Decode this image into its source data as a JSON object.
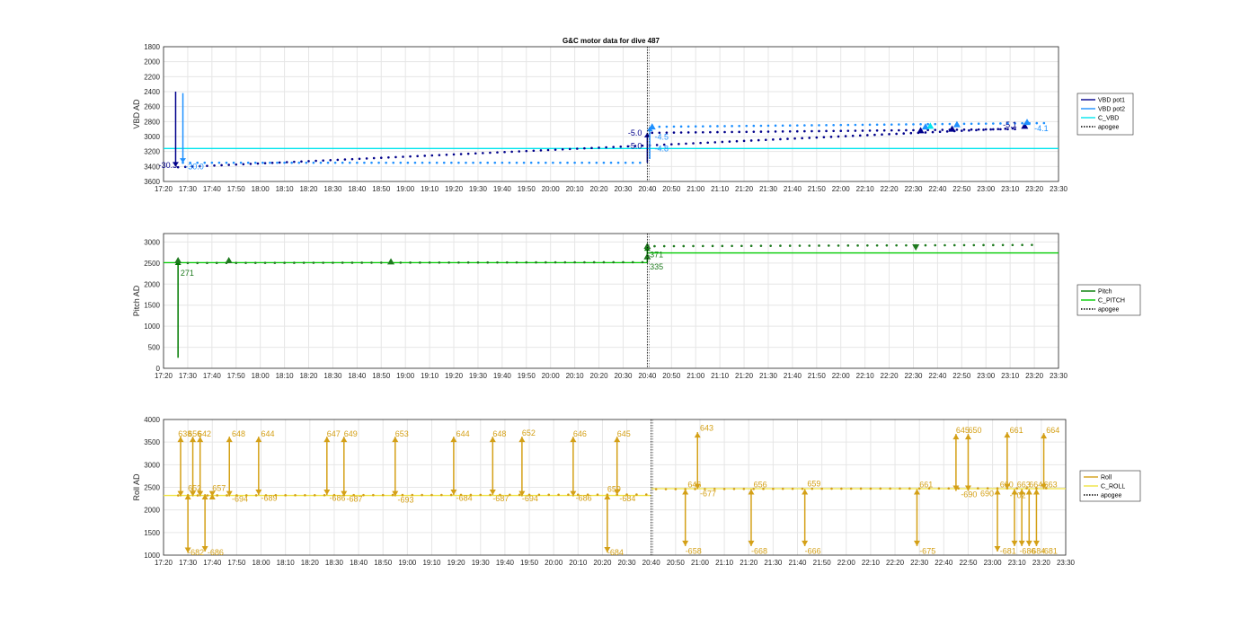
{
  "title": "G&C motor data for dive 487",
  "x_ticks": [
    "17:20",
    "17:30",
    "17:40",
    "17:50",
    "18:00",
    "18:10",
    "18:20",
    "18:30",
    "18:40",
    "18:50",
    "19:00",
    "19:10",
    "19:20",
    "19:30",
    "19:40",
    "19:50",
    "20:00",
    "20:10",
    "20:20",
    "20:30",
    "20:40",
    "20:50",
    "21:00",
    "21:10",
    "21:20",
    "21:30",
    "21:40",
    "21:50",
    "22:00",
    "22:10",
    "22:20",
    "22:30",
    "22:40",
    "22:50",
    "23:00",
    "23:10",
    "23:20",
    "23:30"
  ],
  "apogee_time": "20:40",
  "chart_data": [
    {
      "type": "line",
      "name": "vbd",
      "ylabel": "VBD AD",
      "yreverse": true,
      "ylim": [
        1800,
        3600
      ],
      "yticks": [
        1800,
        2000,
        2200,
        2400,
        2600,
        2800,
        3000,
        3200,
        3400,
        3600
      ],
      "xlim": [
        "17:20",
        "23:30"
      ],
      "grid": true,
      "legend_position": "right",
      "legend": [
        {
          "label": "VBD pot1",
          "color": "#00008b",
          "style": "solid"
        },
        {
          "label": "VBD pot2",
          "color": "#1e90ff",
          "style": "solid"
        },
        {
          "label": "C_VBD",
          "color": "#00e5ee",
          "style": "solid"
        },
        {
          "label": "apogee",
          "color": "#000000",
          "style": "dotted"
        }
      ],
      "series": [
        {
          "name": "VBD pot1",
          "color": "#00008b",
          "dots": [
            [
              "17:26",
              3410
            ],
            [
              "23:12",
              2890
            ]
          ],
          "spacing_min": 3,
          "dots2": [
            [
              "20:42",
              2950
            ],
            [
              "23:14",
              2900
            ]
          ]
        },
        {
          "name": "VBD pot2",
          "color": "#1e90ff",
          "dots": [
            [
              "17:28",
              3350
            ],
            [
              "20:38",
              3350
            ]
          ],
          "spacing_min": 3,
          "dots2": [
            [
              "20:42",
              2870
            ],
            [
              "23:24",
              2820
            ]
          ]
        },
        {
          "name": "C_VBD",
          "color": "#00e5ee",
          "hline_segments": [
            [
              [
                "17:20",
                "20:40"
              ],
              3160
            ],
            [
              [
                "20:40",
                "23:30"
              ],
              3160
            ]
          ]
        }
      ],
      "pumps": [
        {
          "t": "17:25",
          "from": 2400,
          "to": 3400,
          "color": "#00008b"
        },
        {
          "t": "17:28",
          "from": 2420,
          "to": 3350,
          "color": "#1e90ff"
        },
        {
          "t": "20:40",
          "from": 3350,
          "to": 2950,
          "color": "#00008b"
        },
        {
          "t": "20:41",
          "from": 3300,
          "to": 2870,
          "color": "#1e90ff"
        }
      ],
      "markers": [
        {
          "t": "20:42",
          "v": 2870,
          "color": "#1e90ff",
          "dir": "up"
        },
        {
          "t": "22:33",
          "v": 2920,
          "color": "#00008b",
          "dir": "up"
        },
        {
          "t": "22:35",
          "v": 2870,
          "color": "#1e90ff",
          "dir": "up"
        },
        {
          "t": "22:37",
          "v": 2860,
          "color": "#00e5ee",
          "dir": "up"
        },
        {
          "t": "22:46",
          "v": 2900,
          "color": "#00008b",
          "dir": "up"
        },
        {
          "t": "22:48",
          "v": 2840,
          "color": "#1e90ff",
          "dir": "up"
        },
        {
          "t": "23:16",
          "v": 2860,
          "color": "#00008b",
          "dir": "up"
        },
        {
          "t": "23:17",
          "v": 2810,
          "color": "#1e90ff",
          "dir": "up"
        }
      ],
      "annotations": [
        {
          "text": "-5.0",
          "t": "20:32",
          "v": 2990,
          "color": "#00008b"
        },
        {
          "text": "-5.0",
          "t": "20:32",
          "v": 3160,
          "color": "#00008b"
        },
        {
          "text": "-4.5",
          "t": "20:43",
          "v": 3040,
          "color": "#1e90ff"
        },
        {
          "text": "-4.8",
          "t": "20:43",
          "v": 3200,
          "color": "#1e90ff"
        },
        {
          "text": "-5.1",
          "t": "23:07",
          "v": 2880,
          "color": "#00008b"
        },
        {
          "text": "-4.1",
          "t": "23:20",
          "v": 2930,
          "color": "#1e90ff"
        },
        {
          "text": "-30.3",
          "t": "17:18",
          "v": 3420,
          "color": "#00008b"
        },
        {
          "text": "-30.0",
          "t": "17:29",
          "v": 3440,
          "color": "#1e90ff"
        }
      ]
    },
    {
      "type": "line",
      "name": "pitch",
      "ylabel": "Pitch AD",
      "yreverse": false,
      "ylim": [
        0,
        3200
      ],
      "yticks": [
        0,
        500,
        1000,
        1500,
        2000,
        2500,
        3000
      ],
      "xlim": [
        "17:20",
        "23:30"
      ],
      "grid": true,
      "legend_position": "right",
      "legend": [
        {
          "label": "Pitch",
          "color": "#007a00",
          "style": "solid"
        },
        {
          "label": "C_PITCH",
          "color": "#00cc00",
          "style": "solid"
        },
        {
          "label": "apogee",
          "color": "#000000",
          "style": "dotted"
        }
      ],
      "series": [
        {
          "name": "Pitch",
          "color": "#1e7a1e",
          "dots": [
            [
              "17:26",
              2500
            ],
            [
              "20:38",
              2520
            ]
          ],
          "spacing_min": 4,
          "dots2": [
            [
              "20:43",
              2900
            ],
            [
              "23:22",
              2930
            ]
          ]
        },
        {
          "name": "C_PITCH",
          "color": "#00cc00",
          "hline_segments": [
            [
              [
                "17:20",
                "20:40"
              ],
              2510
            ],
            [
              [
                "20:40",
                "23:30"
              ],
              2740
            ]
          ]
        }
      ],
      "pumps": [
        {
          "t": "17:26",
          "from": 250,
          "to": 2560,
          "color": "#007a00"
        },
        {
          "t": "20:40",
          "from": 2500,
          "to": 2900,
          "color": "#007a00"
        }
      ],
      "markers": [
        {
          "t": "17:26",
          "v": 2560,
          "color": "#1e7a1e",
          "dir": "up"
        },
        {
          "t": "17:47",
          "v": 2560,
          "color": "#1e7a1e",
          "dir": "up"
        },
        {
          "t": "18:54",
          "v": 2530,
          "color": "#1e7a1e",
          "dir": "up"
        },
        {
          "t": "20:40",
          "v": 2650,
          "color": "#1e7a1e",
          "dir": "up"
        },
        {
          "t": "20:40",
          "v": 2900,
          "color": "#1e7a1e",
          "dir": "up"
        },
        {
          "t": "22:31",
          "v": 2880,
          "color": "#1e7a1e",
          "dir": "down"
        }
      ],
      "annotations": [
        {
          "text": "271",
          "t": "17:27",
          "v": 2200,
          "color": "#1e7a1e"
        },
        {
          "text": "371",
          "t": "20:41",
          "v": 2630,
          "color": "#1e7a1e"
        },
        {
          "text": "335",
          "t": "20:41",
          "v": 2350,
          "color": "#1e7a1e"
        }
      ]
    },
    {
      "type": "line",
      "name": "roll",
      "ylabel": "Roll AD",
      "yreverse": false,
      "ylim": [
        1000,
        4000
      ],
      "yticks": [
        1000,
        1500,
        2000,
        2500,
        3000,
        3500,
        4000
      ],
      "xlim": [
        "17:20",
        "23:30"
      ],
      "grid": true,
      "legend_position": "right",
      "legend": [
        {
          "label": "Roll",
          "color": "#d4a017",
          "style": "solid"
        },
        {
          "label": "C_ROLL",
          "color": "#f0e442",
          "style": "solid"
        },
        {
          "label": "apogee",
          "color": "#000000",
          "style": "dotted"
        }
      ],
      "series": [
        {
          "name": "Roll",
          "color": "#d4a017",
          "dots": [
            [
              "17:26",
              2320
            ],
            [
              "20:38",
              2340
            ]
          ],
          "spacing_min": 4,
          "dots2": [
            [
              "20:42",
              2460
            ],
            [
              "23:22",
              2480
            ]
          ]
        },
        {
          "name": "C_ROLL",
          "color": "#f0e442",
          "hline_segments": [
            [
              [
                "17:20",
                "20:40"
              ],
              2320
            ],
            [
              [
                "20:40",
                "23:30"
              ],
              2470
            ]
          ]
        }
      ],
      "roll_moves": [
        {
          "t": "17:27",
          "top": 3620,
          "bottom": 2300
        },
        {
          "t": "17:30",
          "top": 2350,
          "bottom": 1050
        },
        {
          "t": "17:32",
          "top": 3620,
          "bottom": 2300
        },
        {
          "t": "17:35",
          "top": 3620,
          "bottom": 2300
        },
        {
          "t": "17:37",
          "top": 2350,
          "bottom": 1080
        },
        {
          "t": "17:40",
          "top": 2350,
          "bottom": 2300
        },
        {
          "t": "17:47",
          "top": 3620,
          "bottom": 2300
        },
        {
          "t": "17:59",
          "top": 3620,
          "bottom": 2330
        },
        {
          "t": "18:27",
          "top": 3620,
          "bottom": 2330
        },
        {
          "t": "18:34",
          "top": 3620,
          "bottom": 2300
        },
        {
          "t": "18:55",
          "top": 3620,
          "bottom": 2300
        },
        {
          "t": "19:19",
          "top": 3620,
          "bottom": 2330
        },
        {
          "t": "19:35",
          "top": 3620,
          "bottom": 2330
        },
        {
          "t": "19:47",
          "top": 3620,
          "bottom": 2300
        },
        {
          "t": "20:08",
          "top": 3620,
          "bottom": 2300
        },
        {
          "t": "20:22",
          "top": 2350,
          "bottom": 1060
        },
        {
          "t": "20:26",
          "top": 3620,
          "bottom": 2330
        },
        {
          "t": "20:54",
          "top": 2460,
          "bottom": 1200
        },
        {
          "t": "20:59",
          "top": 3720,
          "bottom": 2460
        },
        {
          "t": "21:21",
          "top": 2460,
          "bottom": 1200
        },
        {
          "t": "21:43",
          "top": 2460,
          "bottom": 1200
        },
        {
          "t": "22:29",
          "top": 2460,
          "bottom": 1200
        },
        {
          "t": "22:45",
          "top": 3680,
          "bottom": 2420
        },
        {
          "t": "22:50",
          "top": 3680,
          "bottom": 2420
        },
        {
          "t": "23:02",
          "top": 2460,
          "bottom": 1080
        },
        {
          "t": "23:06",
          "top": 3720,
          "bottom": 2460
        },
        {
          "t": "23:09",
          "top": 2460,
          "bottom": 1200
        },
        {
          "t": "23:12",
          "top": 2460,
          "bottom": 1200
        },
        {
          "t": "23:15",
          "top": 2460,
          "bottom": 1200
        },
        {
          "t": "23:18",
          "top": 2460,
          "bottom": 1200
        },
        {
          "t": "23:21",
          "top": 3700,
          "bottom": 2460
        }
      ],
      "annotations": [
        {
          "text": "638",
          "t": "17:26",
          "v": 3620,
          "color": "#d4a017"
        },
        {
          "text": "656",
          "t": "17:30",
          "v": 3620,
          "color": "#d4a017"
        },
        {
          "text": "642",
          "t": "17:34",
          "v": 3620,
          "color": "#d4a017"
        },
        {
          "text": "648",
          "t": "17:48",
          "v": 3620,
          "color": "#d4a017"
        },
        {
          "text": "644",
          "t": "18:00",
          "v": 3620,
          "color": "#d4a017"
        },
        {
          "text": "647",
          "t": "18:27",
          "v": 3620,
          "color": "#d4a017"
        },
        {
          "text": "649",
          "t": "18:34",
          "v": 3620,
          "color": "#d4a017"
        },
        {
          "text": "653",
          "t": "18:55",
          "v": 3620,
          "color": "#d4a017"
        },
        {
          "text": "644",
          "t": "19:20",
          "v": 3620,
          "color": "#d4a017"
        },
        {
          "text": "648",
          "t": "19:35",
          "v": 3620,
          "color": "#d4a017"
        },
        {
          "text": "652",
          "t": "19:47",
          "v": 3640,
          "color": "#d4a017"
        },
        {
          "text": "646",
          "t": "20:08",
          "v": 3620,
          "color": "#d4a017"
        },
        {
          "text": "645",
          "t": "20:26",
          "v": 3620,
          "color": "#d4a017"
        },
        {
          "text": "652",
          "t": "17:30",
          "v": 2420,
          "color": "#d4a017"
        },
        {
          "text": "657",
          "t": "17:40",
          "v": 2420,
          "color": "#d4a017"
        },
        {
          "text": "-694",
          "t": "17:48",
          "v": 2180,
          "color": "#d4a017"
        },
        {
          "text": "-689",
          "t": "18:00",
          "v": 2200,
          "color": "#d4a017"
        },
        {
          "text": "-686",
          "t": "18:28",
          "v": 2200,
          "color": "#d4a017"
        },
        {
          "text": "-687",
          "t": "18:35",
          "v": 2180,
          "color": "#d4a017"
        },
        {
          "text": "-693",
          "t": "18:56",
          "v": 2160,
          "color": "#d4a017"
        },
        {
          "text": "-684",
          "t": "19:20",
          "v": 2200,
          "color": "#d4a017"
        },
        {
          "text": "-687",
          "t": "19:35",
          "v": 2190,
          "color": "#d4a017"
        },
        {
          "text": "-694",
          "t": "19:47",
          "v": 2190,
          "color": "#d4a017"
        },
        {
          "text": "-686",
          "t": "20:09",
          "v": 2200,
          "color": "#d4a017"
        },
        {
          "text": "-684",
          "t": "20:27",
          "v": 2190,
          "color": "#d4a017"
        },
        {
          "text": "659",
          "t": "20:22",
          "v": 2400,
          "color": "#d4a017"
        },
        {
          "text": "-682",
          "t": "17:30",
          "v": 1000,
          "color": "#d4a017"
        },
        {
          "text": "-686",
          "t": "17:38",
          "v": 1000,
          "color": "#d4a017"
        },
        {
          "text": "-684",
          "t": "20:22",
          "v": 1000,
          "color": "#d4a017"
        },
        {
          "text": "643",
          "t": "21:00",
          "v": 3750,
          "color": "#d4a017"
        },
        {
          "text": "646",
          "t": "20:55",
          "v": 2500,
          "color": "#d4a017"
        },
        {
          "text": "-677",
          "t": "21:00",
          "v": 2300,
          "color": "#d4a017"
        },
        {
          "text": "656",
          "t": "21:22",
          "v": 2500,
          "color": "#d4a017"
        },
        {
          "text": "659",
          "t": "21:44",
          "v": 2520,
          "color": "#d4a017"
        },
        {
          "text": "661",
          "t": "22:30",
          "v": 2500,
          "color": "#d4a017"
        },
        {
          "text": "-658",
          "t": "20:54",
          "v": 1030,
          "color": "#d4a017"
        },
        {
          "text": "-668",
          "t": "21:21",
          "v": 1030,
          "color": "#d4a017"
        },
        {
          "text": "-666",
          "t": "21:43",
          "v": 1030,
          "color": "#d4a017"
        },
        {
          "text": "-675",
          "t": "22:30",
          "v": 1030,
          "color": "#d4a017"
        },
        {
          "text": "645",
          "t": "22:45",
          "v": 3700,
          "color": "#d4a017"
        },
        {
          "text": "650",
          "t": "22:50",
          "v": 3700,
          "color": "#d4a017"
        },
        {
          "text": "-690",
          "t": "22:47",
          "v": 2280,
          "color": "#d4a017"
        },
        {
          "text": "690",
          "t": "22:55",
          "v": 2300,
          "color": "#d4a017"
        },
        {
          "text": "661",
          "t": "23:07",
          "v": 3700,
          "color": "#d4a017"
        },
        {
          "text": "660",
          "t": "23:03",
          "v": 2500,
          "color": "#d4a017"
        },
        {
          "text": "663",
          "t": "23:10",
          "v": 2500,
          "color": "#d4a017"
        },
        {
          "text": "664",
          "t": "23:15",
          "v": 2500,
          "color": "#d4a017"
        },
        {
          "text": "663",
          "t": "23:21",
          "v": 2500,
          "color": "#d4a017"
        },
        {
          "text": "664",
          "t": "23:22",
          "v": 3700,
          "color": "#d4a017"
        },
        {
          "text": "-702",
          "t": "23:07",
          "v": 2260,
          "color": "#d4a017"
        },
        {
          "text": "-681",
          "t": "23:03",
          "v": 1030,
          "color": "#d4a017"
        },
        {
          "text": "-686",
          "t": "23:11",
          "v": 1030,
          "color": "#d4a017"
        },
        {
          "text": "-684",
          "t": "23:15",
          "v": 1030,
          "color": "#d4a017"
        },
        {
          "text": "-681",
          "t": "23:20",
          "v": 1030,
          "color": "#d4a017"
        }
      ]
    }
  ]
}
